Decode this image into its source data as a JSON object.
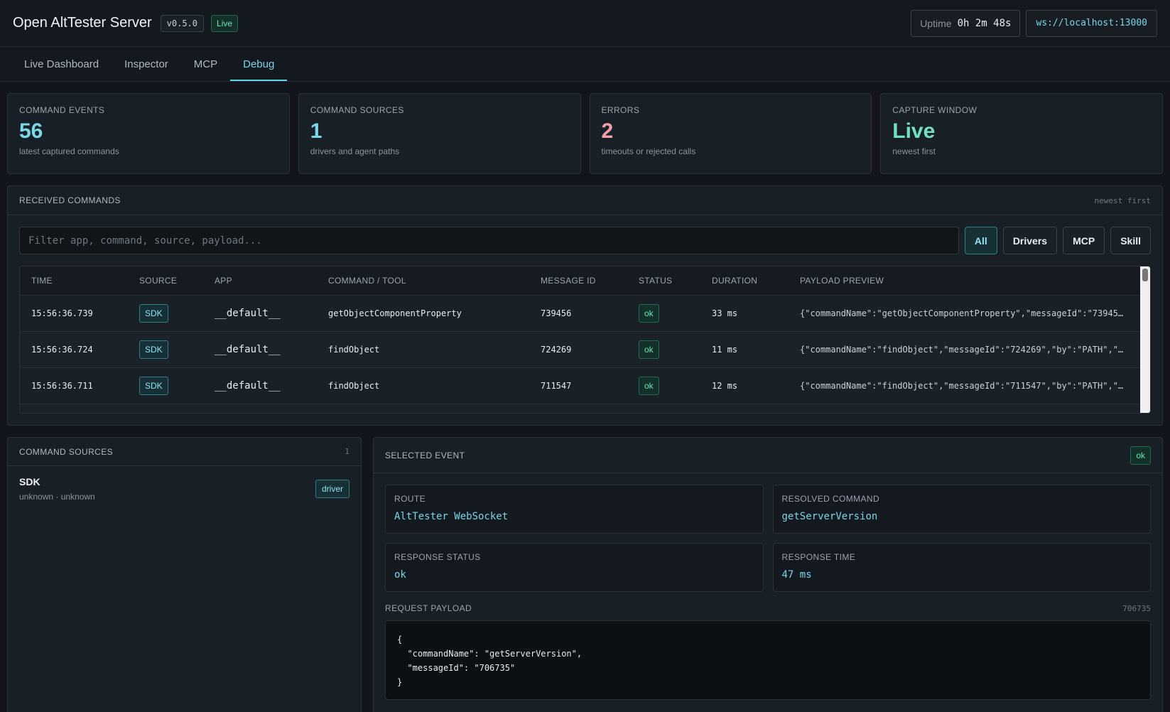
{
  "header": {
    "title": "Open AltTester Server",
    "version": "v0.5.0",
    "live_label": "Live",
    "uptime_label": "Uptime",
    "uptime_value": "0h 2m 48s",
    "ws_url": "ws://localhost:13000"
  },
  "tabs": [
    {
      "label": "Live Dashboard"
    },
    {
      "label": "Inspector"
    },
    {
      "label": "MCP"
    },
    {
      "label": "Debug",
      "active": true
    }
  ],
  "stats": [
    {
      "label": "COMMAND EVENTS",
      "value": "56",
      "sub": "latest captured commands"
    },
    {
      "label": "COMMAND SOURCES",
      "value": "1",
      "sub": "drivers and agent paths"
    },
    {
      "label": "ERRORS",
      "value": "2",
      "sub": "timeouts or rejected calls"
    },
    {
      "label": "CAPTURE WINDOW",
      "value": "Live",
      "sub": "newest first"
    }
  ],
  "received": {
    "title": "RECEIVED COMMANDS",
    "order_hint": "newest first",
    "filter_placeholder": "Filter app, command, source, payload...",
    "filters": [
      "All",
      "Drivers",
      "MCP",
      "Skill"
    ],
    "columns": [
      "TIME",
      "SOURCE",
      "APP",
      "COMMAND / TOOL",
      "MESSAGE ID",
      "STATUS",
      "DURATION",
      "PAYLOAD PREVIEW"
    ],
    "rows": [
      {
        "time": "15:56:36.739",
        "source": "SDK",
        "app": "__default__",
        "command": "getObjectComponentProperty",
        "message_id": "739456",
        "status": "ok",
        "duration": "33 ms",
        "payload": "{\"commandName\":\"getObjectComponentProperty\",\"messageId\":\"73945…"
      },
      {
        "time": "15:56:36.724",
        "source": "SDK",
        "app": "__default__",
        "command": "findObject",
        "message_id": "724269",
        "status": "ok",
        "duration": "11 ms",
        "payload": "{\"commandName\":\"findObject\",\"messageId\":\"724269\",\"by\":\"PATH\",\"…"
      },
      {
        "time": "15:56:36.711",
        "source": "SDK",
        "app": "__default__",
        "command": "findObject",
        "message_id": "711547",
        "status": "ok",
        "duration": "12 ms",
        "payload": "{\"commandName\":\"findObject\",\"messageId\":\"711547\",\"by\":\"PATH\",\"…"
      }
    ]
  },
  "sources": {
    "title": "COMMAND SOURCES",
    "count": "1",
    "items": [
      {
        "name": "SDK",
        "meta": "unknown · unknown",
        "kind": "driver"
      }
    ]
  },
  "selected": {
    "title": "SELECTED EVENT",
    "status": "ok",
    "route_label": "ROUTE",
    "route_value": "AltTester WebSocket",
    "resolved_label": "RESOLVED COMMAND",
    "resolved_value": "getServerVersion",
    "resp_status_label": "RESPONSE STATUS",
    "resp_status_value": "ok",
    "resp_time_label": "RESPONSE TIME",
    "resp_time_value": "47 ms",
    "payload_label": "REQUEST PAYLOAD",
    "payload_id": "706735",
    "payload_text": "{\n  \"commandName\": \"getServerVersion\",\n  \"messageId\": \"706735\"\n}"
  }
}
